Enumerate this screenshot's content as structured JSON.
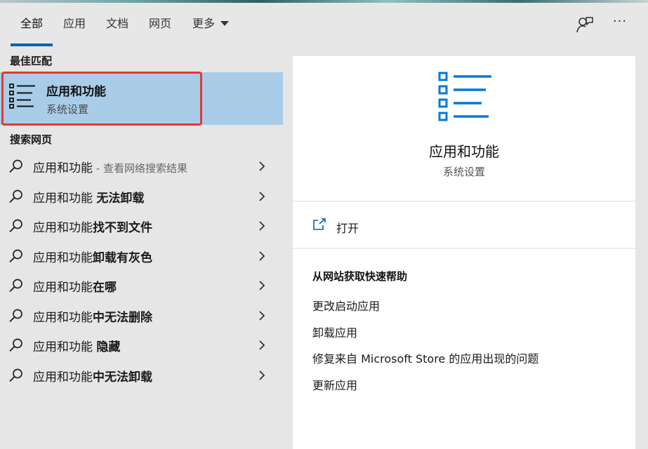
{
  "tabs": [
    {
      "label": "全部",
      "active": true
    },
    {
      "label": "应用"
    },
    {
      "label": "文档"
    },
    {
      "label": "网页"
    },
    {
      "label": "更多"
    }
  ],
  "toolbar": {
    "feedback_icon": "feedback-person-icon",
    "more_options": "···"
  },
  "best_match": {
    "section_title": "最佳匹配",
    "title": "应用和功能",
    "subtitle": "系统设置",
    "icon": "list-settings-icon"
  },
  "web_search": {
    "section_title": "搜索网页",
    "items": [
      {
        "prefix": "应用和功能",
        "bold": "",
        "hint": " - 查看网络搜索结果"
      },
      {
        "prefix": "应用和功能 ",
        "bold": "无法卸载",
        "hint": ""
      },
      {
        "prefix": "应用和功能",
        "bold": "找不到文件",
        "hint": ""
      },
      {
        "prefix": "应用和功能",
        "bold": "卸载有灰色",
        "hint": ""
      },
      {
        "prefix": "应用和功能",
        "bold": "在哪",
        "hint": ""
      },
      {
        "prefix": "应用和功能",
        "bold": "中无法删除",
        "hint": ""
      },
      {
        "prefix": "应用和功能 ",
        "bold": "隐藏",
        "hint": ""
      },
      {
        "prefix": "应用和功能",
        "bold": "中无法卸载",
        "hint": ""
      }
    ]
  },
  "detail": {
    "title": "应用和功能",
    "subtitle": "系统设置",
    "open_label": "打开",
    "help_title": "从网站获取快速帮助",
    "help_links": [
      "更改启动应用",
      "卸载应用",
      "修复来自 Microsoft Store 的应用出现的问题",
      "更新应用"
    ]
  },
  "colors": {
    "accent": "#0063b1",
    "selected_bg": "#a9cde9",
    "highlight_outline": "#e23a32",
    "icon_blue": "#0078d7"
  }
}
